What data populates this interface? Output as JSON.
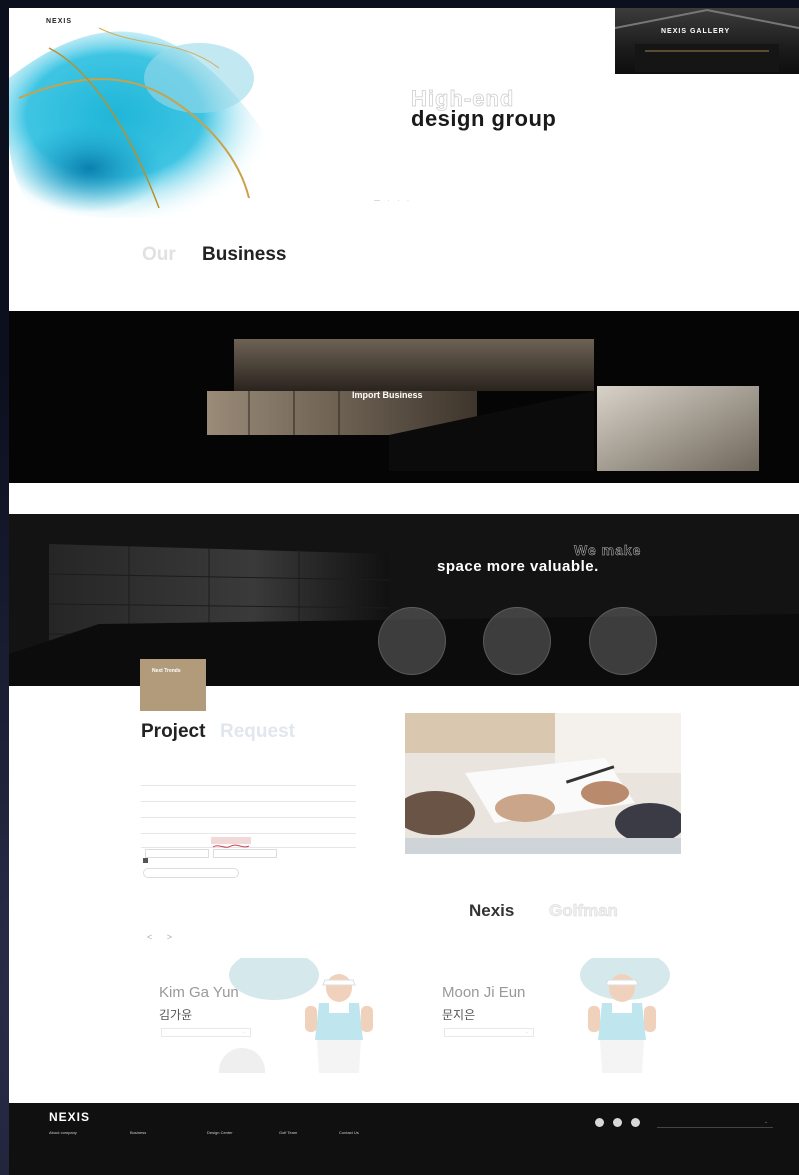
{
  "hero": {
    "logo": "NEXIS",
    "gallery_label": "NEXIS GALLERY",
    "subtitle": "High-end",
    "title": "design group",
    "description": "",
    "dots": "— ·  ·  ·"
  },
  "business": {
    "title_light": "Our",
    "title_dark": "Business",
    "line": "",
    "desc": "",
    "card_label": "Import Business",
    "card_sub": ""
  },
  "space": {
    "headline_outline": "We make",
    "headline": "space more valuable.",
    "desc": "",
    "circles": [
      {
        "title": "",
        "desc": ""
      },
      {
        "title": "",
        "desc": ""
      },
      {
        "title": "",
        "desc": ""
      }
    ],
    "trend_title": "Next Trends",
    "trend_desc": ""
  },
  "project": {
    "title_dark": "Project",
    "title_light": "Request",
    "desc": "",
    "form_note": "",
    "fields": [
      {
        "label": "",
        "value": ""
      },
      {
        "label": "",
        "value": ""
      },
      {
        "label": "",
        "value": ""
      },
      {
        "label": "",
        "value": ""
      },
      {
        "label": "",
        "value": ""
      }
    ],
    "buttons": [
      "",
      ""
    ],
    "agree": "",
    "submit": ""
  },
  "golfman": {
    "title_dark": "Nexis",
    "title_light": "Golfman",
    "desc": "",
    "arrows": "< >",
    "players": [
      {
        "name_en": "Kim Ga Yun",
        "name_ko": "김가윤",
        "button": ""
      },
      {
        "name_en": "Moon Ji Eun",
        "name_ko": "문지은",
        "button": ""
      }
    ]
  },
  "footer": {
    "logo": "NEXIS",
    "columns": [
      {
        "title": "About company",
        "items": []
      },
      {
        "title": "Business",
        "items": []
      },
      {
        "title": "Design Center",
        "items": []
      },
      {
        "title": "Golf Team",
        "items": []
      },
      {
        "title": "Contact Us",
        "items": []
      }
    ],
    "family_site": "",
    "info": [],
    "copyright": ""
  },
  "colors": {
    "accent_gold": "#b29b7b",
    "dark_bg": "#0b0f1e"
  }
}
